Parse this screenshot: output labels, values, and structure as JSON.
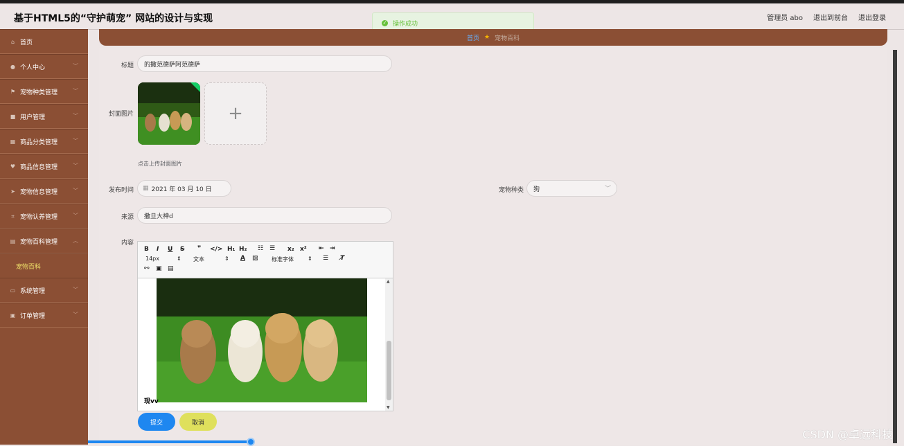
{
  "app": {
    "title": "基于HTML5的“守护萌宠” 网站的设计与实现",
    "nav": [
      "管理员 abo",
      "退出到前台",
      "退出登录"
    ]
  },
  "toast": {
    "message": "操作成功"
  },
  "sidebar": {
    "items": [
      {
        "label": "首页",
        "icon": "home-icon"
      },
      {
        "label": "个人中心",
        "icon": "user-icon"
      },
      {
        "label": "宠物种类管理",
        "icon": "flag-icon"
      },
      {
        "label": "用户管理",
        "icon": "briefcase-icon"
      },
      {
        "label": "商品分类管理",
        "icon": "grid-icon"
      },
      {
        "label": "商品信息管理",
        "icon": "location-icon"
      },
      {
        "label": "宠物信息管理",
        "icon": "send-icon"
      },
      {
        "label": "宠物认养管理",
        "icon": "crop-icon"
      },
      {
        "label": "宠物百科管理",
        "icon": "document-icon"
      },
      {
        "label": "系统管理",
        "icon": "monitor-icon"
      },
      {
        "label": "订单管理",
        "icon": "bag-icon"
      }
    ],
    "submenu": "宠物百科"
  },
  "breadcrumb": {
    "home": "首页",
    "current": "宠物百科"
  },
  "form": {
    "title_label": "标题",
    "title_value": "的撒范德萨阿范德萨",
    "cover_label": "封面图片",
    "cover_tip": "点击上传封面图片",
    "date_label": "发布时间",
    "date_value": "2021 年 03 月 10 日",
    "category_label": "宠物种类",
    "category_value": "狗",
    "source_label": "来源",
    "source_value": "撒旦大神d",
    "content_label": "内容",
    "content_text": "现vv"
  },
  "editor": {
    "font_size": "14px",
    "text_style": "文本",
    "font_family": "标准字体"
  },
  "buttons": {
    "submit": "提交",
    "cancel": "取消"
  },
  "watermark": "CSDN @卓远科技"
}
